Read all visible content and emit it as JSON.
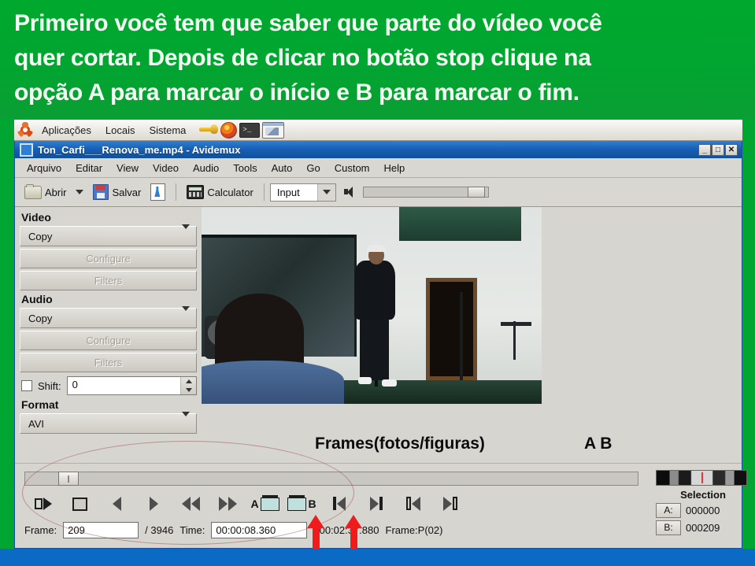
{
  "banner": {
    "lines": [
      "Primeiro você tem que saber que parte do vídeo você",
      "quer cortar. Depois de clicar no botão stop clique na",
      "opção A para marcar o início e B para marcar o fim."
    ]
  },
  "gnome_panel": {
    "logo_icon": "ubuntu-logo-icon",
    "menus": [
      "Aplicações",
      "Locais",
      "Sistema"
    ],
    "launchers": [
      {
        "icon": "key-tool-icon",
        "name": "preferences-launcher"
      },
      {
        "icon": "firefox-icon",
        "name": "firefox-launcher"
      },
      {
        "icon": "terminal-icon",
        "name": "terminal-launcher"
      },
      {
        "icon": "screenshot-icon",
        "name": "screenshot-launcher"
      }
    ]
  },
  "window": {
    "title": "Ton_Carfi___Renova_me.mp4 - Avidemux",
    "title_icon": "window-icon",
    "buttons": {
      "minimize": "_",
      "maximize": "□",
      "close": "✕"
    }
  },
  "menubar": {
    "items": [
      "Arquivo",
      "Editar",
      "View",
      "Video",
      "Audio",
      "Tools",
      "Auto",
      "Go",
      "Custom",
      "Help"
    ]
  },
  "toolbar": {
    "open_label": "Abrir",
    "open_icon": "folder-icon",
    "open_dropdown_icon": "chevron-down-icon",
    "save_label": "Salvar",
    "save_icon": "floppy-disk-icon",
    "config_icon": "document-wrench-icon",
    "calculator_label": "Calculator",
    "calculator_icon": "calculator-icon",
    "input_value": "Input",
    "input_dropdown_icon": "chevron-down-icon",
    "volume_icon": "speaker-icon"
  },
  "sidebar": {
    "video": {
      "title": "Video",
      "codec": "Copy",
      "configure": "Configure",
      "filters": "Filters"
    },
    "audio": {
      "title": "Audio",
      "codec": "Copy",
      "configure": "Configure",
      "filters": "Filters",
      "shift_label": "Shift:",
      "shift_value": "0"
    },
    "format": {
      "title": "Format",
      "container": "AVI"
    }
  },
  "overlays": {
    "frames_label": "Frames(fotos/figuras)",
    "ab_label": "A  B",
    "arrow_color": "#ee1c1c"
  },
  "transport": {
    "buttons": [
      {
        "name": "play-button",
        "icon": "play-icon"
      },
      {
        "name": "stop-button",
        "icon": "stop-icon"
      },
      {
        "name": "previous-frame-button",
        "icon": "triangle-left-icon"
      },
      {
        "name": "next-frame-button",
        "icon": "triangle-right-icon"
      },
      {
        "name": "rewind-button",
        "icon": "double-triangle-left-icon"
      },
      {
        "name": "forward-button",
        "icon": "double-triangle-right-icon"
      },
      {
        "name": "mark-a-button",
        "icon": "marker-a-icon",
        "label": "A"
      },
      {
        "name": "mark-b-button",
        "icon": "marker-b-icon",
        "label": "B"
      },
      {
        "name": "go-start-button",
        "icon": "skip-start-icon"
      },
      {
        "name": "go-end-button",
        "icon": "skip-end-icon"
      },
      {
        "name": "prev-keyframe-button",
        "icon": "prev-keyframe-icon"
      },
      {
        "name": "next-keyframe-button",
        "icon": "next-keyframe-icon"
      }
    ]
  },
  "statusbar": {
    "frame_label": "Frame:",
    "frame_value": "209",
    "frame_total": "/ 3946",
    "time_label": "Time:",
    "time_value": "00:00:08.360",
    "time_total": "/ 00:02:37.880",
    "frame_type": "Frame:P(02)"
  },
  "selection": {
    "title": "Selection",
    "a_label": "A:",
    "a_value": "000000",
    "b_label": "B:",
    "b_value": "000209"
  },
  "colors": {
    "banner_green": "#00a630",
    "titlebar_blue": "#1861b5",
    "window_gray": "#d7d5d0",
    "desktop_blue": "#0a6ac4"
  }
}
